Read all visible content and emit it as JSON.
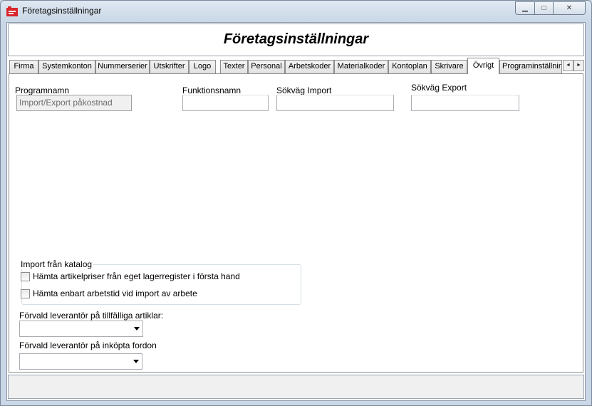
{
  "window": {
    "title": "Företagsinställningar",
    "controls": {
      "minimize": "▁",
      "maximize": "□",
      "close": "✕"
    }
  },
  "header": {
    "title": "Företagsinställningar"
  },
  "tabs": [
    {
      "label": "Firma"
    },
    {
      "label": "Systemkonton"
    },
    {
      "label": "Nummerserier"
    },
    {
      "label": "Utskrifter"
    },
    {
      "label": "Logo"
    },
    {
      "label": "Texter"
    },
    {
      "label": "Personal"
    },
    {
      "label": "Arbetskoder"
    },
    {
      "label": "Materialkoder"
    },
    {
      "label": "Kontoplan"
    },
    {
      "label": "Skrivare"
    },
    {
      "label": "Övrigt",
      "active": true
    },
    {
      "label": "Programinställningar"
    }
  ],
  "tab_scroll": {
    "left": "◄",
    "right": "►"
  },
  "ovrigt": {
    "programnamn_label": "Programnamn",
    "programnamn_value": "Import/Export påkostnad",
    "funktionsnamn_label": "Funktionsnamn",
    "funktionsnamn_value": "",
    "sokvag_import_label": "Sökväg Import",
    "sokvag_import_value": "",
    "sokvag_export_label": "Sökväg Export",
    "sokvag_export_value": "",
    "import_group": {
      "title": "Import från katalog",
      "options": [
        {
          "label": "Hämta artikelpriser från eget lagerregister i första hand",
          "checked": false
        },
        {
          "label": "Hämta enbart arbetstid vid import av arbete",
          "checked": false
        }
      ]
    },
    "leverantor_tillfalliga_label": "Förvald leverantör på tillfälliga artiklar:",
    "leverantor_tillfalliga_value": "",
    "leverantor_fordon_label": "Förvald leverantör på inköpta fordon",
    "leverantor_fordon_value": ""
  },
  "colors": {
    "accent": "#d9252b",
    "frame": "#c9d7e6"
  }
}
